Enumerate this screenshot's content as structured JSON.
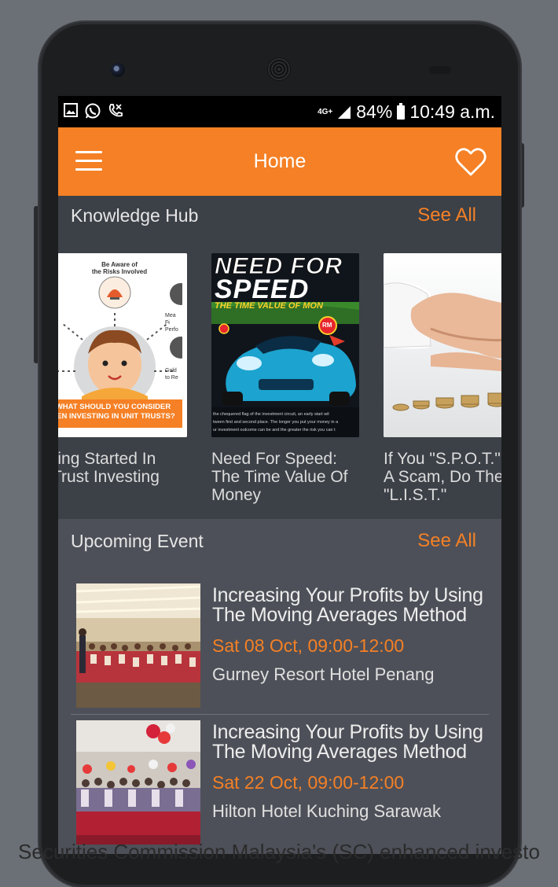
{
  "status_bar": {
    "network": "4G+",
    "battery": "84%",
    "time": "10:49 a.m.",
    "icons": [
      "gallery-icon",
      "whatsapp-icon",
      "missed-call-icon"
    ]
  },
  "app_bar": {
    "title": "Home",
    "menu_icon": "hamburger-menu-icon",
    "favorites_icon": "heart-icon"
  },
  "knowledge_hub": {
    "title": "Knowledge Hub",
    "see_all": "See All",
    "items": [
      {
        "label": "etting Started In\nit Trust Investing",
        "thumb": {
          "heading": "Be Aware of\nthe Risks Involved",
          "snippets": [
            "ial",
            "Mea",
            "Fi",
            "Perfo",
            "nd",
            "the",
            "Gold",
            "to Re"
          ],
          "banner": "WHAT SHOULD YOU CONSIDER\nHEN INVESTING IN UNIT TRUSTS?"
        }
      },
      {
        "label": "Need For Speed:\nThe Time Value Of\nMoney",
        "thumb": {
          "title_line1": "NEED FOR",
          "title_line2": "SPEED",
          "subtitle": "THE TIME VALUE OF MON",
          "badge": "RM",
          "caption": "the chequered flag of the investment circuit, an early start wil\ntween first and second place. The longer you put your money in a\nur investment outcome can be and the greater the risk you can t"
        }
      },
      {
        "label": "If You \"S.P.O.T.\"\nA Scam, Do The\n\"L.I.S.T.\""
      }
    ]
  },
  "upcoming_event": {
    "title": "Upcoming Event",
    "see_all": "See All",
    "events": [
      {
        "title": "Increasing Your Profits by Using The Moving Averages Method",
        "date": "Sat 08 Oct, 09:00-12:00",
        "venue": "Gurney Resort Hotel Penang"
      },
      {
        "title": "Increasing Your Profits by Using The Moving Averages Method",
        "date": "Sat 22 Oct, 09:00-12:00",
        "venue": "Hilton Hotel Kuching Sarawak"
      }
    ]
  },
  "footer": {
    "text": "Securities Commission Malaysia's (SC) enhanced investo"
  },
  "colors": {
    "accent": "#f58025",
    "screen_bg": "#3d4148",
    "event_bg": "#4d5058",
    "page_bg": "#6b6f76"
  }
}
